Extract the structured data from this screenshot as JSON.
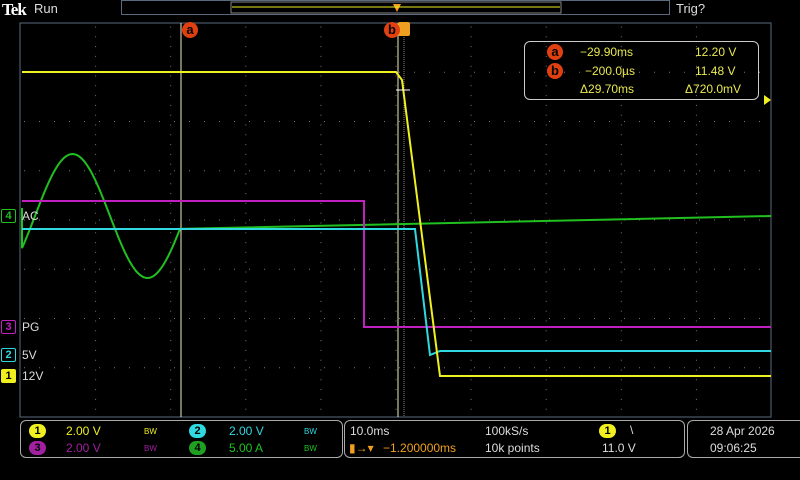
{
  "header": {
    "brand": "Tek",
    "status": "Run",
    "trigger_state": "Trig?"
  },
  "colors": {
    "ch1": "#f0f020",
    "ch2": "#30d8e0",
    "ch3": "#c020c0",
    "ch4": "#20c020",
    "cursor": "#e04010",
    "trigger": "#f0a020"
  },
  "cursors": {
    "a_label": "a",
    "b_label": "b",
    "a_time": "−29.90ms",
    "a_value": "12.20 V",
    "b_time": "−200.0µs",
    "b_value": "11.48 V",
    "delta_time": "Δ29.70ms",
    "delta_value": "Δ720.0mV"
  },
  "trace_labels": {
    "ch4": "AC",
    "ch3": "PG",
    "ch2": "5V",
    "ch1": "12V"
  },
  "channels": [
    {
      "num": "1",
      "scale": "2.00 V",
      "bw": "BW"
    },
    {
      "num": "2",
      "scale": "2.00 V",
      "bw": "BW"
    },
    {
      "num": "3",
      "scale": "2.00 V",
      "bw": "BW"
    },
    {
      "num": "4",
      "scale": "5.00 A",
      "bw": "BW"
    }
  ],
  "timebase": {
    "scale": "10.0ms",
    "sample_rate": "100kS/s",
    "position": "−1.200000ms",
    "record_length": "10k points"
  },
  "trigger": {
    "source": "1",
    "slope": "\\",
    "level": "11.0 V"
  },
  "datetime": {
    "date": "28 Apr  2026",
    "time": "09:06:25"
  }
}
